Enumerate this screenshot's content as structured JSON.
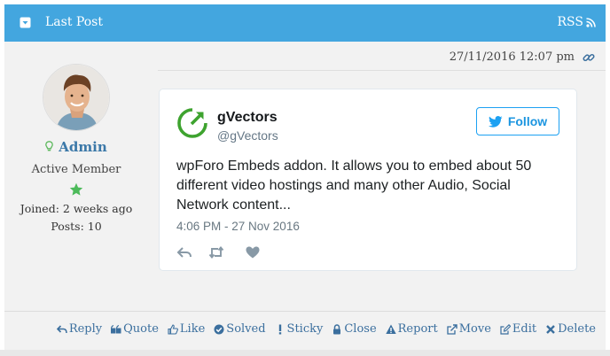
{
  "header": {
    "title": "Last Post",
    "rss_label": "RSS"
  },
  "post": {
    "date": "27/11/2016 12:07 pm"
  },
  "author": {
    "name": "Admin",
    "role": "Active Member",
    "joined": "Joined: 2 weeks  ago",
    "posts": "Posts: 10"
  },
  "tweet": {
    "name": "gVectors",
    "handle": "@gVectors",
    "follow_label": "Follow",
    "text": "wpForo Embeds addon. It allows you to embed about 50 different video hostings and many other Audio, Social Network content...",
    "time": "4:06 PM - 27 Nov 2016"
  },
  "actions": [
    {
      "label": "Reply",
      "icon": "reply-icon"
    },
    {
      "label": "Quote",
      "icon": "quote-icon"
    },
    {
      "label": "Like",
      "icon": "thumbs-up-icon"
    },
    {
      "label": "Solved",
      "icon": "check-circle-icon"
    },
    {
      "label": "Sticky",
      "icon": "exclamation-icon"
    },
    {
      "label": "Close",
      "icon": "lock-icon"
    },
    {
      "label": "Report",
      "icon": "warning-icon"
    },
    {
      "label": "Move",
      "icon": "move-icon"
    },
    {
      "label": "Edit",
      "icon": "edit-icon"
    },
    {
      "label": "Delete",
      "icon": "times-icon"
    }
  ],
  "colors": {
    "header_bg": "#43a6df",
    "link": "#3b6f9e",
    "twitter_blue": "#1da1f2",
    "gvectors_green": "#3ea32f",
    "star_green": "#4cba5a"
  }
}
